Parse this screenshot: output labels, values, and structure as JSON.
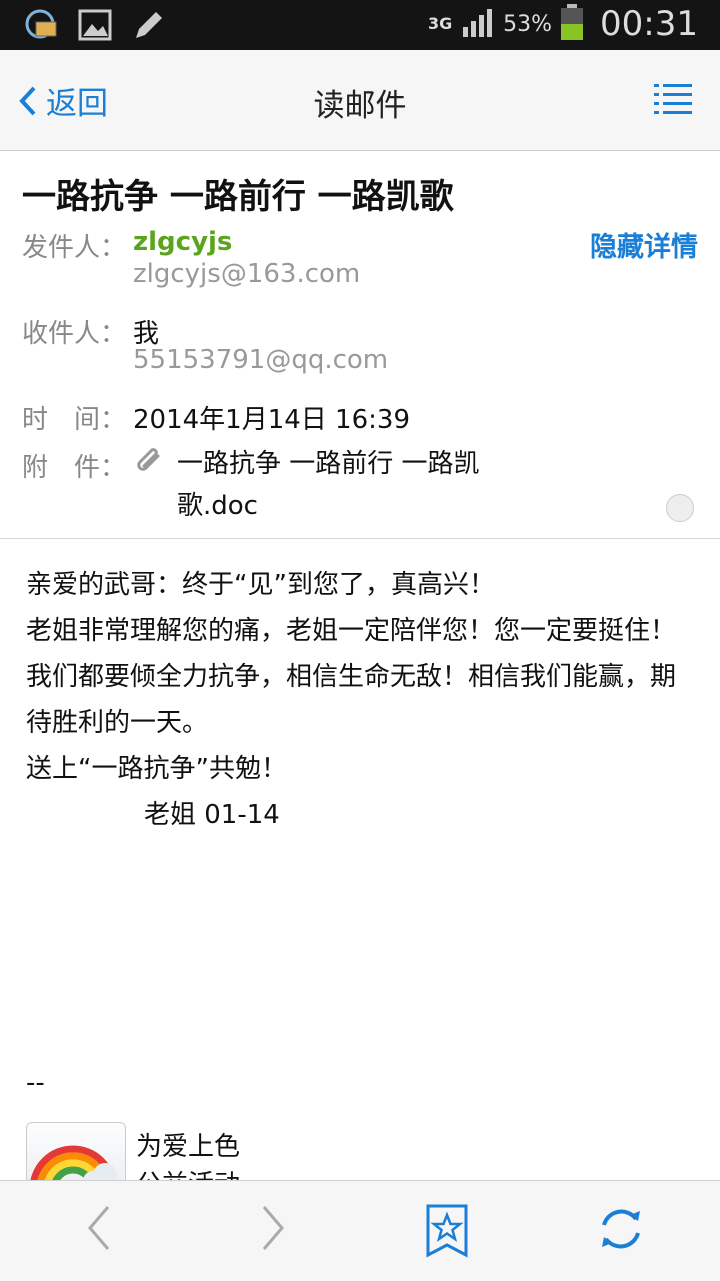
{
  "status_bar": {
    "network": "3G",
    "battery_percent": "53%",
    "time": "00:31",
    "icons": [
      "qq-mail-notify-icon",
      "image-notify-icon",
      "pencil-notify-icon",
      "signal-icon",
      "battery-icon"
    ]
  },
  "nav": {
    "back_label": "返回",
    "title": "读邮件"
  },
  "email": {
    "subject": "一路抗争 一路前行 一路凯歌",
    "from_label": "发件人：",
    "from_name": "zlgcyjs",
    "from_email": "zlgcyjs@163.com",
    "hide_details": "隐藏详情",
    "to_label": "收件人：",
    "to_name": "我",
    "to_email": "55153791@qq.com",
    "time_label": "时　间：",
    "time_value": "2014年1月14日 16:39",
    "attach_label": "附　件：",
    "attachment_name": "一路抗争 一路前行 一路凯歌.doc"
  },
  "body": {
    "lines": [
      "亲爱的武哥：终于“见”到您了，真高兴！",
      "老姐非常理解您的痛，老姐一定陪伴您！您一定要挺住！我们都要倾全力抗争，相信生命无敌！相信我们能赢，期待胜利的一天。",
      "送上“一路抗争”共勉！",
      "老姐   01-14"
    ],
    "separator": "--",
    "signature_line1": "为爱上色",
    "signature_line2": "公益活动"
  },
  "colors": {
    "accent": "#1b7fd6",
    "sender_green": "#5ba51e"
  }
}
